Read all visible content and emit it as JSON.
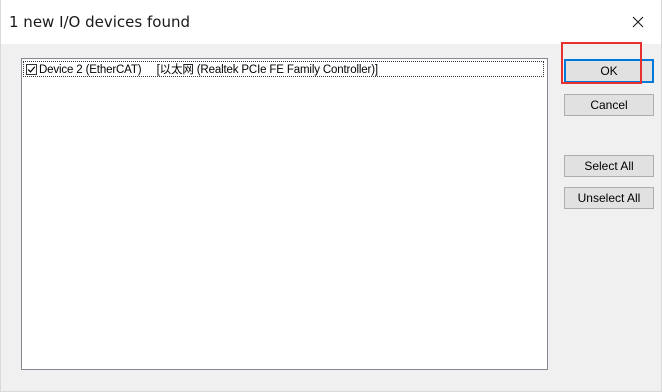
{
  "window": {
    "title": "1 new I/O devices found",
    "close_icon": "close-icon"
  },
  "device_list": {
    "items": [
      {
        "checked": true,
        "label": "Device 2 (EtherCAT)     [以太网 (Realtek PCIe FE Family Controller)]"
      }
    ]
  },
  "buttons": {
    "ok": "OK",
    "cancel": "Cancel",
    "select_all": "Select All",
    "unselect_all": "Unselect All"
  },
  "colors": {
    "focus_border": "#0078d7",
    "highlight_annotation": "#e8312f"
  }
}
